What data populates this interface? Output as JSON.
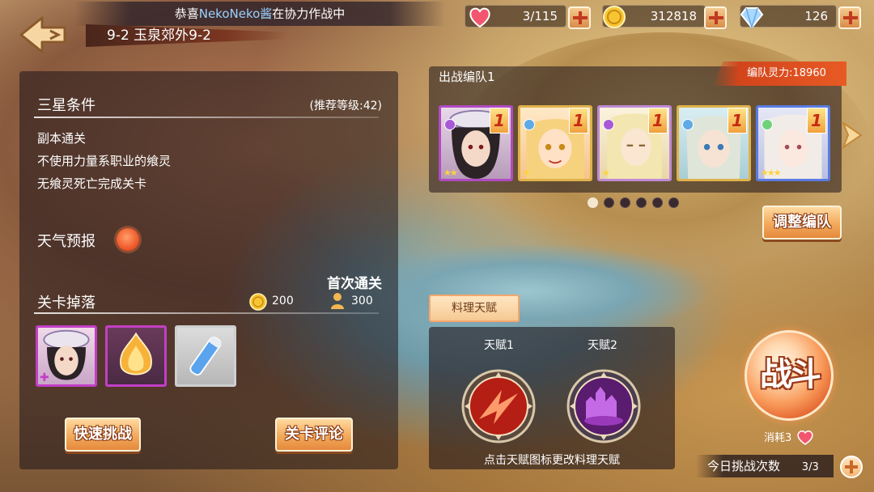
{
  "header": {
    "marquee_prefix": "恭喜",
    "marquee_name": "NekoNeko酱",
    "marquee_suffix": "在协力作战中",
    "stage_title": "9-2 玉泉郊外9-2"
  },
  "resources": {
    "stamina": "3/115",
    "gold": "312818",
    "crystal": "126"
  },
  "conditions": {
    "title": "三星条件",
    "recommended": "(推荐等级:42)",
    "items": [
      "副本通关",
      "不使用力量系职业的飨灵",
      "无飨灵死亡完成关卡"
    ]
  },
  "weather": {
    "label": "天气预报",
    "icon": "sun-icon"
  },
  "drops": {
    "label": "关卡掉落",
    "first_clear": "首次通关",
    "gold_amount": "200",
    "exp_amount": "300",
    "items": [
      {
        "icon": "character-portrait-icon",
        "frame": "#c23fc5"
      },
      {
        "icon": "flame-bulb-icon",
        "frame": "#c23fc5"
      },
      {
        "icon": "potion-vial-icon",
        "frame": "#cfcfcf"
      }
    ]
  },
  "buttons": {
    "quick_battle": "快速挑战",
    "stage_comments": "关卡评论",
    "adjust_team": "调整编队",
    "battle": "战斗"
  },
  "team": {
    "label": "出战编队1",
    "power": "编队灵力:18960",
    "members": [
      {
        "level": "1",
        "stars": "★★",
        "frame": "#b14ac2",
        "hair": "#2b2326",
        "skin": "#f4d9c9",
        "cls_color": "#a85ad6"
      },
      {
        "level": "1",
        "stars": "★",
        "frame": "#e0b24a",
        "hair": "#f6d27e",
        "skin": "#ffe1c6",
        "cls_color": "#5fa9e6"
      },
      {
        "level": "1",
        "stars": "★",
        "frame": "#c08ad4",
        "hair": "#f4e6b0",
        "skin": "#fbe6d2",
        "cls_color": "#a85ad6"
      },
      {
        "level": "1",
        "stars": "",
        "frame": "#e0b24a",
        "hair": "#dfe6d9",
        "skin": "#f6e3d3",
        "cls_color": "#5fa9e6"
      },
      {
        "level": "1",
        "stars": "★★★",
        "frame": "#5a7be0",
        "hair": "#f2ece8",
        "skin": "#fbe9df",
        "cls_color": "#6fd27a"
      }
    ],
    "page_count": 6,
    "active_page": 0
  },
  "cooking": {
    "tab": "料理天赋",
    "talent1": "天赋1",
    "talent2": "天赋2",
    "hint": "点击天赋图标更改料理天赋"
  },
  "battle": {
    "cost_label": "消耗3",
    "daily_label": "今日挑战次数",
    "daily_count": "3/3"
  },
  "colors": {
    "accent": "#f3a95b",
    "panel": "#1e1419",
    "heart": "#f2556e"
  }
}
